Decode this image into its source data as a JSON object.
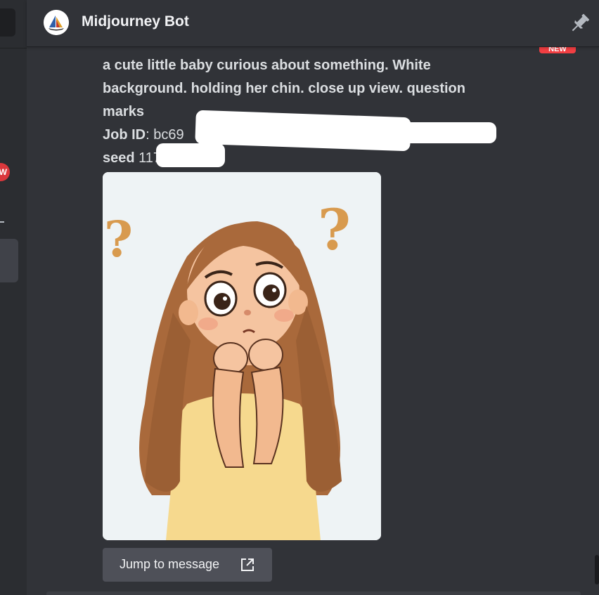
{
  "header": {
    "bot_name": "Midjourney Bot",
    "avatar_icon": "midjourney-sailboat-icon",
    "pin_icon": "pin-icon"
  },
  "sidebar": {
    "badge_text": "W"
  },
  "badge": {
    "new_label": "NEW"
  },
  "message": {
    "prompt_line1": "a cute little baby curious about something. White",
    "prompt_line2": "background. holding her chin. close up view. question",
    "prompt_line3": "marks",
    "job_id_label": "Job ID",
    "job_id_value": ": bc69",
    "seed_label": "seed",
    "seed_value": " 117"
  },
  "jump": {
    "label": "Jump to message",
    "icon": "external-link-icon"
  },
  "colors": {
    "background": "#313338",
    "sidebar": "#2b2d31",
    "button": "#4e5058",
    "badge_red": "#f23f43"
  }
}
